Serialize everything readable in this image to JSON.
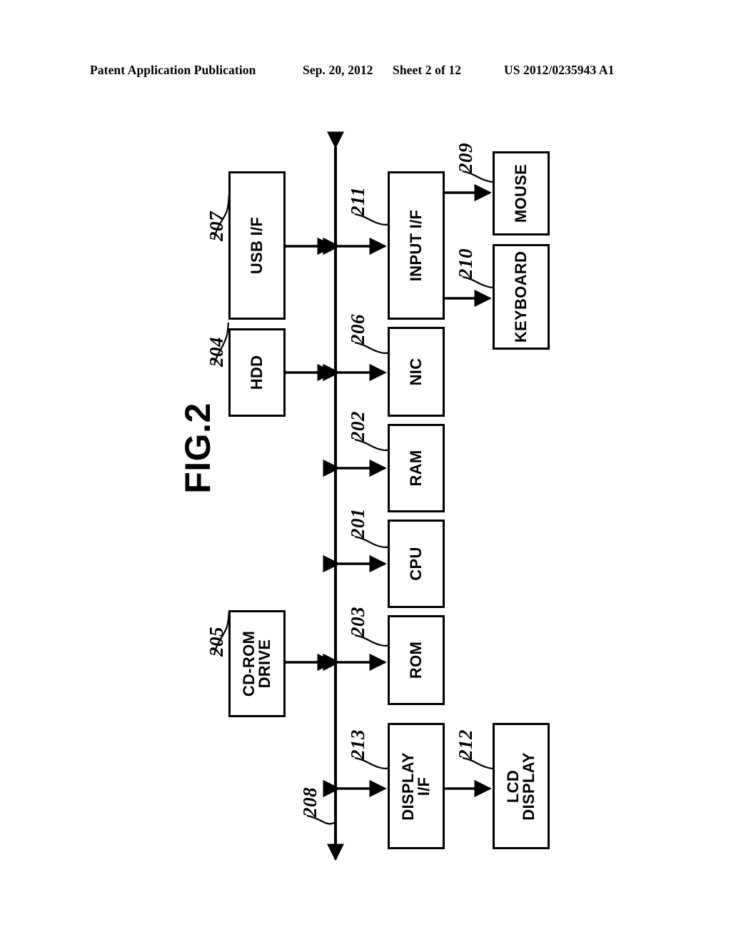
{
  "header": {
    "publication": "Patent Application Publication",
    "date": "Sep. 20, 2012",
    "sheet": "Sheet 2 of 12",
    "patent_number": "US 2012/0235943 A1"
  },
  "figure": {
    "title": "FIG.2",
    "bus_ref": "208",
    "nodes": [
      {
        "id": "usb-if",
        "label": "USB I/F",
        "ref": "207"
      },
      {
        "id": "hdd",
        "label": "HDD",
        "ref": "204"
      },
      {
        "id": "cdrom-drive",
        "label": "CD-ROM\nDRIVE",
        "ref": "205"
      },
      {
        "id": "input-if",
        "label": "INPUT I/F",
        "ref": "211"
      },
      {
        "id": "nic",
        "label": "NIC",
        "ref": "206"
      },
      {
        "id": "ram",
        "label": "RAM",
        "ref": "202"
      },
      {
        "id": "cpu",
        "label": "CPU",
        "ref": "201"
      },
      {
        "id": "rom",
        "label": "ROM",
        "ref": "203"
      },
      {
        "id": "display-if",
        "label": "DISPLAY\nI/F",
        "ref": "213"
      },
      {
        "id": "mouse",
        "label": "MOUSE",
        "ref": "209"
      },
      {
        "id": "keyboard",
        "label": "KEYBOARD",
        "ref": "210"
      },
      {
        "id": "lcd-display",
        "label": "LCD\nDISPLAY",
        "ref": "212"
      }
    ]
  },
  "colors": {
    "ink": "#000000",
    "paper": "#ffffff"
  }
}
